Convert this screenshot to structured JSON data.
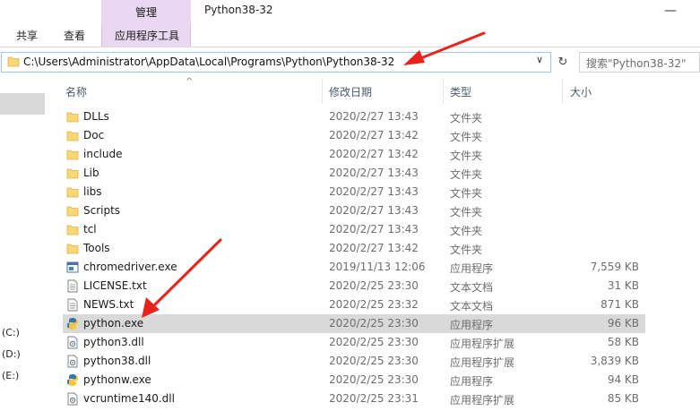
{
  "ribbon": {
    "share_tab": "共享",
    "view_tab": "查看",
    "manage_tab": "管理",
    "app_tools_tab": "应用程序工具"
  },
  "window": {
    "title": "Python38-32",
    "minimize_glyph": "—"
  },
  "address_bar": {
    "path": "C:\\Users\\Administrator\\AppData\\Local\\Programs\\Python\\Python38-32",
    "chevron": "∨",
    "refresh_glyph": "↻"
  },
  "search": {
    "placeholder": "搜索\"Python38-32\""
  },
  "sidebar": {
    "drives": [
      "(C:)",
      "(D:)",
      "(E:)"
    ]
  },
  "columns": {
    "name": "名称",
    "modified": "修改日期",
    "type": "类型",
    "size": "大小",
    "sort_glyph": "^"
  },
  "files": [
    {
      "name": "DLLs",
      "modified": "2020/2/27 13:43",
      "type": "文件夹",
      "size": "",
      "icon": "folder-icon"
    },
    {
      "name": "Doc",
      "modified": "2020/2/27 13:42",
      "type": "文件夹",
      "size": "",
      "icon": "folder-icon"
    },
    {
      "name": "include",
      "modified": "2020/2/27 13:42",
      "type": "文件夹",
      "size": "",
      "icon": "folder-icon"
    },
    {
      "name": "Lib",
      "modified": "2020/2/27 13:43",
      "type": "文件夹",
      "size": "",
      "icon": "folder-icon"
    },
    {
      "name": "libs",
      "modified": "2020/2/27 13:43",
      "type": "文件夹",
      "size": "",
      "icon": "folder-icon"
    },
    {
      "name": "Scripts",
      "modified": "2020/2/27 13:43",
      "type": "文件夹",
      "size": "",
      "icon": "folder-icon"
    },
    {
      "name": "tcl",
      "modified": "2020/2/27 13:43",
      "type": "文件夹",
      "size": "",
      "icon": "folder-icon"
    },
    {
      "name": "Tools",
      "modified": "2020/2/27 13:42",
      "type": "文件夹",
      "size": "",
      "icon": "folder-icon"
    },
    {
      "name": "chromedriver.exe",
      "modified": "2019/11/13 12:06",
      "type": "应用程序",
      "size": "7,559 KB",
      "icon": "exe-icon"
    },
    {
      "name": "LICENSE.txt",
      "modified": "2020/2/25 23:30",
      "type": "文本文档",
      "size": "31 KB",
      "icon": "text-file-icon"
    },
    {
      "name": "NEWS.txt",
      "modified": "2020/2/25 23:32",
      "type": "文本文档",
      "size": "871 KB",
      "icon": "text-file-icon"
    },
    {
      "name": "python.exe",
      "modified": "2020/2/25 23:30",
      "type": "应用程序",
      "size": "96 KB",
      "icon": "python-icon",
      "selected": true
    },
    {
      "name": "python3.dll",
      "modified": "2020/2/25 23:30",
      "type": "应用程序扩展",
      "size": "58 KB",
      "icon": "dll-icon"
    },
    {
      "name": "python38.dll",
      "modified": "2020/2/25 23:30",
      "type": "应用程序扩展",
      "size": "3,839 KB",
      "icon": "dll-icon"
    },
    {
      "name": "pythonw.exe",
      "modified": "2020/2/25 23:30",
      "type": "应用程序",
      "size": "94 KB",
      "icon": "python-icon"
    },
    {
      "name": "vcruntime140.dll",
      "modified": "2020/2/25 23:31",
      "type": "应用程序扩展",
      "size": "85 KB",
      "icon": "dll-icon"
    }
  ],
  "colors": {
    "accent_tab": "#ead7f1",
    "selection": "#d9d9d9",
    "folder": "#f8d775",
    "arrow": "#e8231b",
    "address_border": "#9ec6ea"
  }
}
